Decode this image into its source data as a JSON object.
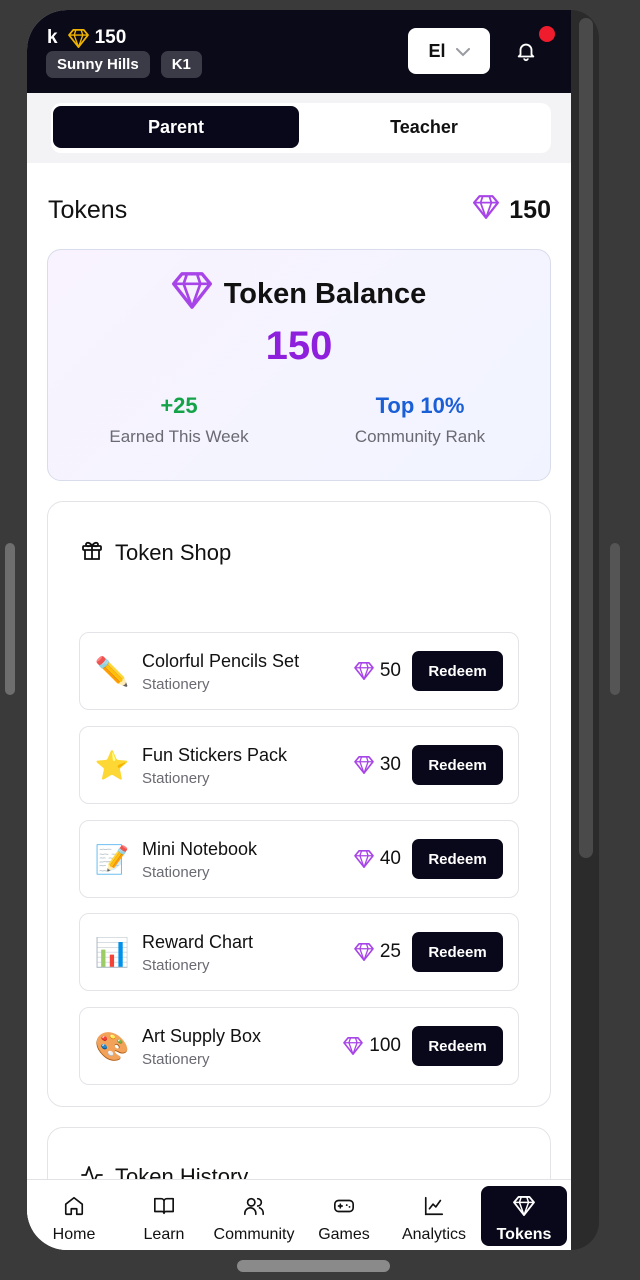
{
  "header": {
    "user_initial": "k",
    "token_count": "150",
    "chips": [
      "Sunny Hills",
      "K1"
    ],
    "language": "El"
  },
  "roles": {
    "parent": "Parent",
    "teacher": "Teacher",
    "active": "Parent"
  },
  "tokens_section": {
    "title": "Tokens",
    "balance": "150"
  },
  "balance_card": {
    "title": "Token Balance",
    "value": "150",
    "earned_value": "+25",
    "earned_label": "Earned This Week",
    "rank_value": "Top 10%",
    "rank_label": "Community Rank"
  },
  "shop": {
    "title": "Token Shop",
    "redeem_label": "Redeem",
    "items": [
      {
        "emoji": "✏️",
        "name": "Colorful Pencils Set",
        "category": "Stationery",
        "price": "50"
      },
      {
        "emoji": "⭐",
        "name": "Fun Stickers Pack",
        "category": "Stationery",
        "price": "30"
      },
      {
        "emoji": "📝",
        "name": "Mini Notebook",
        "category": "Stationery",
        "price": "40"
      },
      {
        "emoji": "📊",
        "name": "Reward Chart",
        "category": "Stationery",
        "price": "25"
      },
      {
        "emoji": "🎨",
        "name": "Art Supply Box",
        "category": "Stationery",
        "price": "100"
      }
    ]
  },
  "history": {
    "title": "Token History"
  },
  "nav": {
    "items": [
      {
        "label": "Home",
        "icon": "home-icon"
      },
      {
        "label": "Learn",
        "icon": "book-icon"
      },
      {
        "label": "Community",
        "icon": "users-icon"
      },
      {
        "label": "Games",
        "icon": "gamepad-icon"
      },
      {
        "label": "Analytics",
        "icon": "chart-line-icon"
      },
      {
        "label": "Tokens",
        "icon": "gem-icon"
      }
    ],
    "active": "Tokens"
  },
  "colors": {
    "accent_purple": "#8e1fdc",
    "earned_green": "#15a34a",
    "rank_blue": "#1a5fd6",
    "header_dark": "#0a0a18",
    "gem_gold": "#f0b400"
  }
}
